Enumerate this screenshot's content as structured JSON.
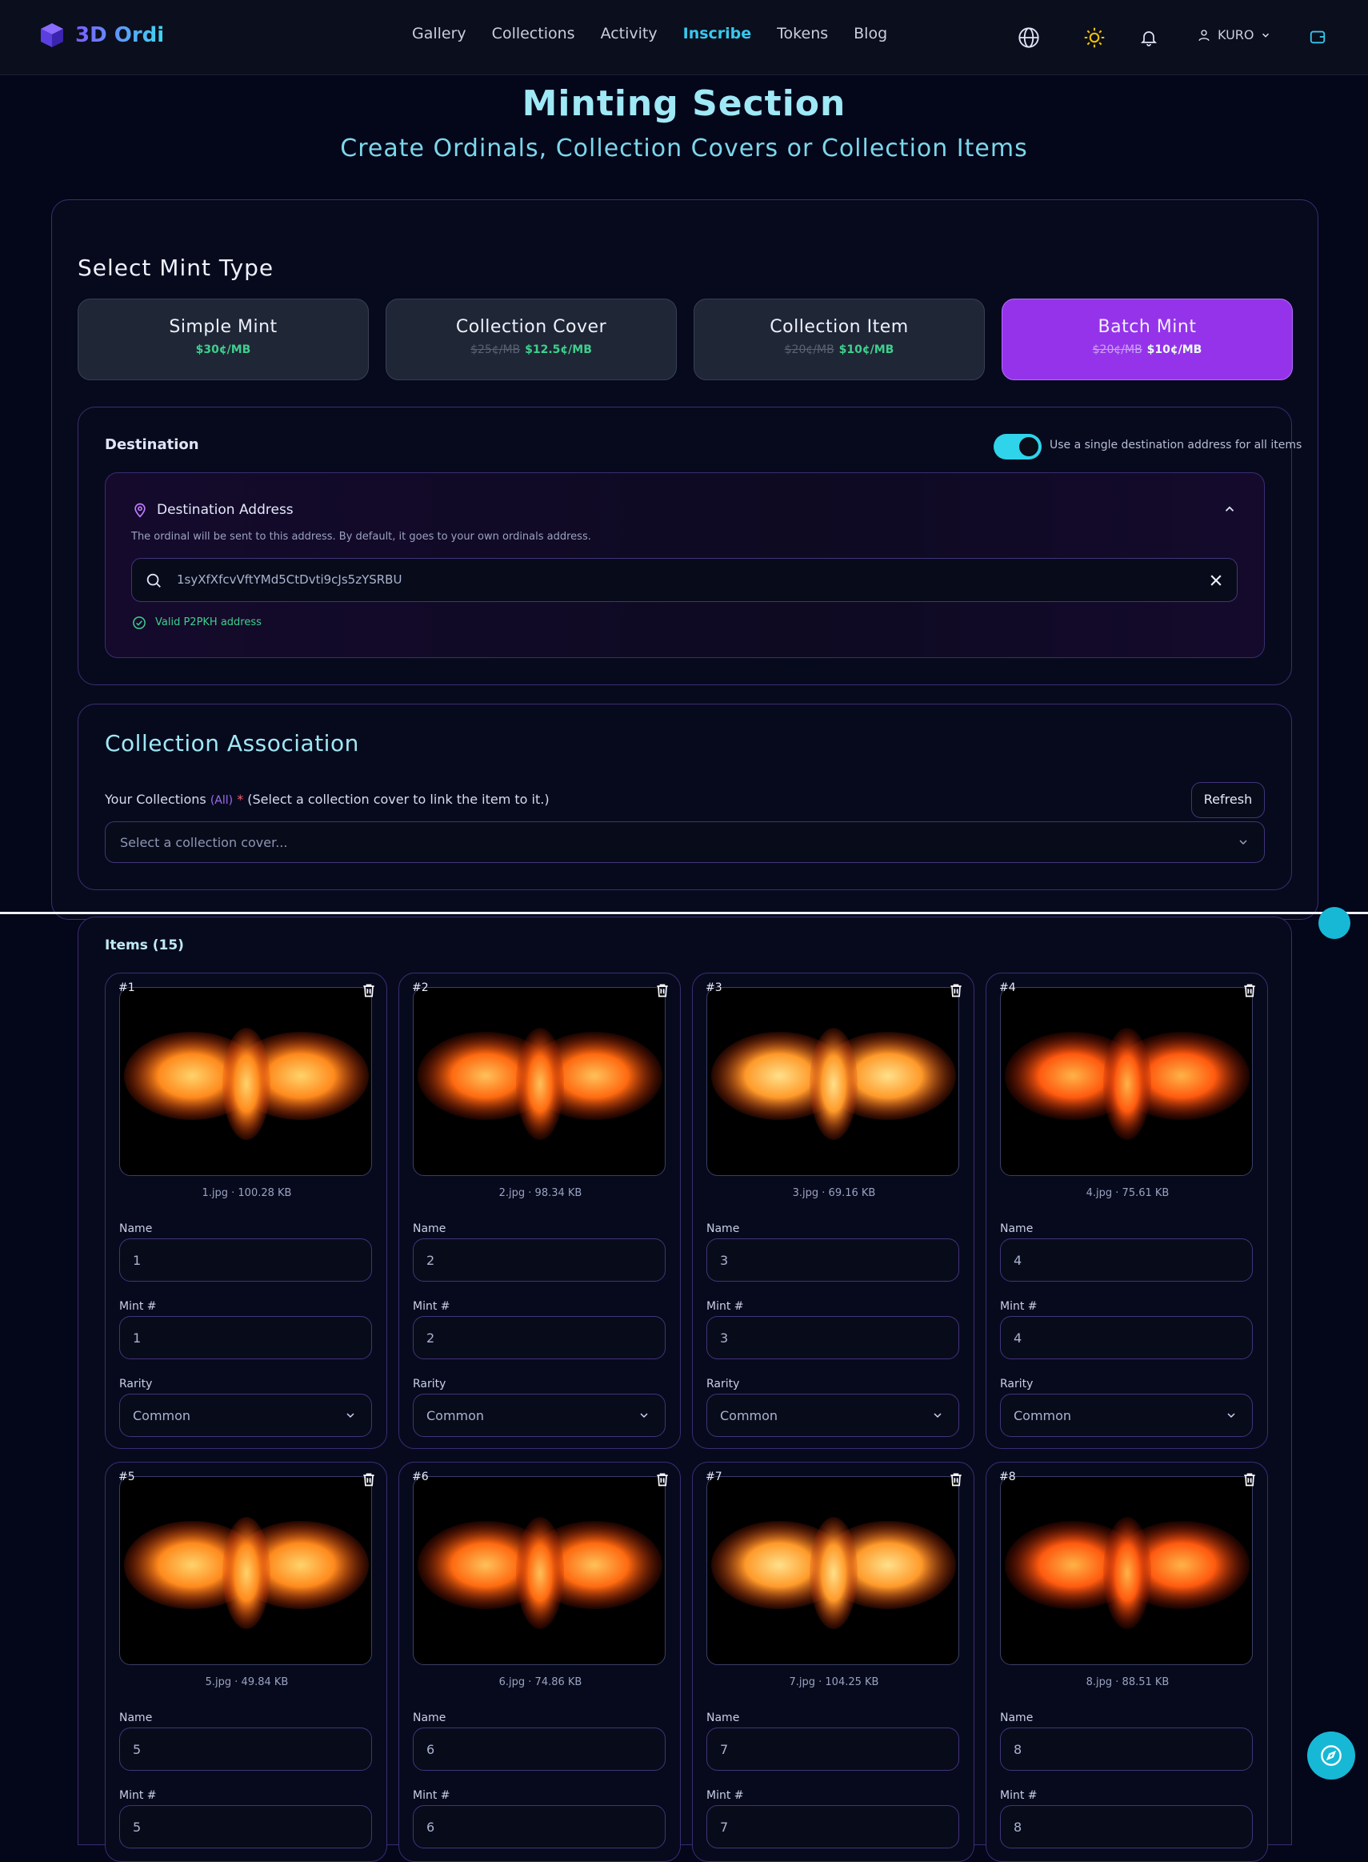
{
  "nav": {
    "logo": "3D Ordi",
    "links": [
      "Gallery",
      "Collections",
      "Activity",
      "Inscribe",
      "Tokens",
      "Blog"
    ],
    "active": "Inscribe",
    "user": "KURO"
  },
  "hero": {
    "title": "Minting Section",
    "subtitle": "Create Ordinals, Collection Covers or Collection Items"
  },
  "mint": {
    "heading": "Select Mint Type",
    "options": [
      {
        "title": "Simple Mint",
        "old_price": "",
        "price": "$30¢/MB"
      },
      {
        "title": "Collection Cover",
        "old_price": "$25¢/MB",
        "price": "$12.5¢/MB"
      },
      {
        "title": "Collection Item",
        "old_price": "$20¢/MB",
        "price": "$10¢/MB"
      },
      {
        "title": "Batch Mint",
        "old_price": "$20¢/MB",
        "price": "$10¢/MB"
      }
    ],
    "selected": "Batch Mint"
  },
  "destination": {
    "label": "Destination",
    "toggle_label": "Use a single destination address for all items",
    "toggle_on": true,
    "box_title": "Destination Address",
    "description": "The ordinal will be sent to this address. By default, it goes to your own ordinals address.",
    "address": "1syXfXfcvVftYMd5CtDvti9cJs5zYSRBU",
    "valid_text": "Valid P2PKH address"
  },
  "collection": {
    "title": "Collection Association",
    "label": "Your Collections",
    "all": "(All)",
    "required": "*",
    "hint": "(Select a collection cover to link the item to it.)",
    "refresh": "Refresh",
    "placeholder": "Select a collection cover..."
  },
  "items": {
    "title": "Items (15)",
    "field_name": "Name",
    "field_mint": "Mint #",
    "field_rarity": "Rarity",
    "list": [
      {
        "idx": "#1",
        "file": "1.jpg · 100.28 KB",
        "name": "1",
        "mint": "1",
        "rarity": "Common"
      },
      {
        "idx": "#2",
        "file": "2.jpg · 98.34 KB",
        "name": "2",
        "mint": "2",
        "rarity": "Common"
      },
      {
        "idx": "#3",
        "file": "3.jpg · 69.16 KB",
        "name": "3",
        "mint": "3",
        "rarity": "Common"
      },
      {
        "idx": "#4",
        "file": "4.jpg · 75.61 KB",
        "name": "4",
        "mint": "4",
        "rarity": "Common"
      },
      {
        "idx": "#5",
        "file": "5.jpg · 49.84 KB",
        "name": "5",
        "mint": "5",
        "rarity": ""
      },
      {
        "idx": "#6",
        "file": "6.jpg · 74.86 KB",
        "name": "6",
        "mint": "6",
        "rarity": ""
      },
      {
        "idx": "#7",
        "file": "7.jpg · 104.25 KB",
        "name": "7",
        "mint": "7",
        "rarity": ""
      },
      {
        "idx": "#8",
        "file": "8.jpg · 88.51 KB",
        "name": "8",
        "mint": "8",
        "rarity": ""
      }
    ]
  },
  "colors": {
    "accent": "#38c8ee",
    "purple": "#9533ea",
    "green": "#3ed08c",
    "bg": "#04061a"
  },
  "icons": [
    "cube-logo-icon",
    "globe-icon",
    "sun-icon",
    "bell-icon",
    "user-icon",
    "chevron-down-icon",
    "wallet-icon",
    "map-pin-icon",
    "chevron-up-icon",
    "search-icon",
    "close-icon",
    "check-circle-icon",
    "trash-icon",
    "compass-icon"
  ]
}
